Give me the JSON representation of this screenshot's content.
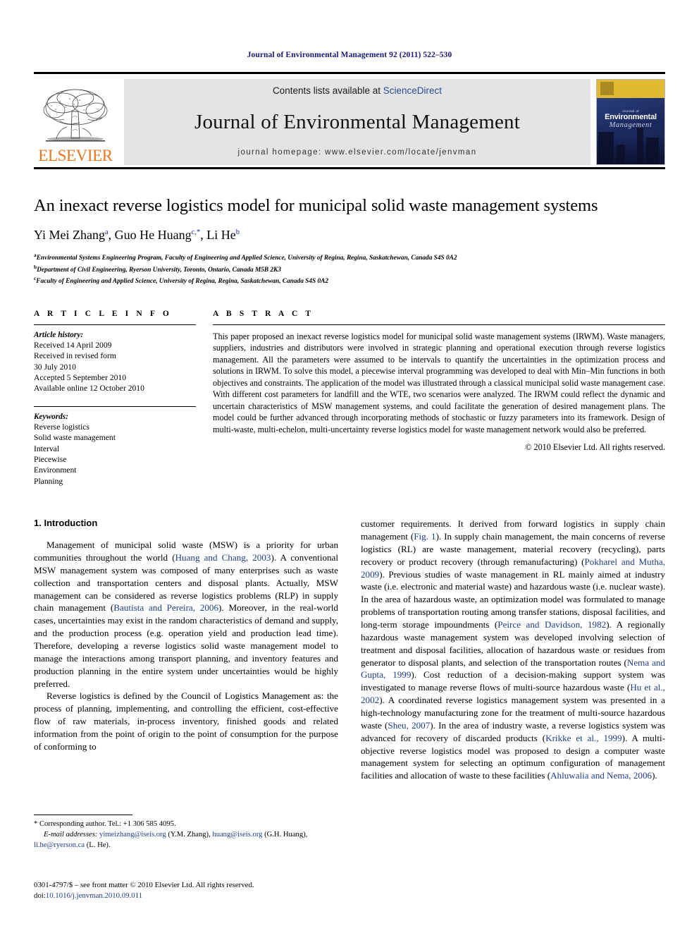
{
  "running_head": "Journal of Environmental Management 92 (2011) 522–530",
  "masthead": {
    "elsevier_wordmark": "ELSEVIER",
    "contents_prefix": "Contents lists available at ",
    "sciencedirect": "ScienceDirect",
    "journal_title": "Journal of Environmental Management",
    "homepage": "journal homepage: www.elsevier.com/locate/jenvman",
    "cover": {
      "sup": "Journal of",
      "line1": "Environmental",
      "line2": "Management"
    },
    "colors": {
      "link_blue": "#2a4b9b",
      "elsevier_orange": "#e87722",
      "banner_gray": "#e4e4e4",
      "cover_band": "#e0b832",
      "cover_blue": "#1d2f6b"
    }
  },
  "article": {
    "title": "An inexact reverse logistics model for municipal solid waste management systems",
    "authors_html": "Yi Mei Zhang <sup>a</sup>, Guo He Huang <sup>c,</sup>*, Li He <sup>b</sup>",
    "authors_plain": "Yi Mei Zhang a, Guo He Huang c,*, Li He b",
    "affiliations": [
      {
        "marker": "a",
        "text": "Environmental Systems Engineering Program, Faculty of Engineering and Applied Science, University of Regina, Regina, Saskatchewan, Canada S4S 0A2"
      },
      {
        "marker": "b",
        "text": "Department of Civil Engineering, Ryerson University, Toronto, Ontario, Canada M5B 2K3"
      },
      {
        "marker": "c",
        "text": "Faculty of Engineering and Applied Science, University of Regina, Regina, Saskatchewan, Canada S4S 0A2"
      }
    ]
  },
  "article_info": {
    "heading": "A R T I C L E   I N F O",
    "history_label": "Article history:",
    "history": [
      "Received 14 April 2009",
      "Received in revised form",
      "30 July 2010",
      "Accepted 5 September 2010",
      "Available online 12 October 2010"
    ],
    "keywords_label": "Keywords:",
    "keywords": [
      "Reverse logistics",
      "Solid waste management",
      "Interval",
      "Piecewise",
      "Environment",
      "Planning"
    ]
  },
  "abstract": {
    "heading": "A B S T R A C T",
    "text": "This paper proposed an inexact reverse logistics model for municipal solid waste management systems (IRWM). Waste managers, suppliers, industries and distributors were involved in strategic planning and operational execution through reverse logistics management. All the parameters were assumed to be intervals to quantify the uncertainties in the optimization process and solutions in IRWM. To solve this model, a piecewise interval programming was developed to deal with Min–Min functions in both objectives and constraints. The application of the model was illustrated through a classical municipal solid waste management case. With different cost parameters for landfill and the WTE, two scenarios were analyzed. The IRWM could reflect the dynamic and uncertain characteristics of MSW management systems, and could facilitate the generation of desired management plans. The model could be further advanced through incorporating methods of stochastic or fuzzy parameters into its framework. Design of multi-waste, multi-echelon, multi-uncertainty reverse logistics model for waste management network would also be preferred.",
    "copyright": "© 2010 Elsevier Ltd. All rights reserved."
  },
  "body": {
    "section_heading": "1. Introduction",
    "left_paragraphs": [
      "Management of municipal solid waste (MSW) is a priority for urban communities throughout the world (Huang and Chang, 2003). A conventional MSW management system was composed of many enterprises such as waste collection and transportation centers and disposal plants. Actually, MSW management can be considered as reverse logistics problems (RLP) in supply chain management (Bautista and Pereira, 2006). Moreover, in the real-world cases, uncertainties may exist in the random characteristics of demand and supply, and the production process (e.g. operation yield and production lead time). Therefore, developing a reverse logistics solid waste management model to manage the interactions among transport planning, and inventory features and production planning in the entire system under uncertainties would be highly preferred.",
      "Reverse logistics is defined by the Council of Logistics Management as: the process of planning, implementing, and controlling the efficient, cost-effective flow of raw materials, in-process inventory, finished goods and related information from the point of origin to the point of consumption for the purpose of conforming to"
    ],
    "right_paragraphs": [
      "customer requirements. It derived from forward logistics in supply chain management (Fig. 1). In supply chain management, the main concerns of reverse logistics (RL) are waste management, material recovery (recycling), parts recovery or product recovery (through remanufacturing) (Pokharel and Mutha, 2009). Previous studies of waste management in RL mainly aimed at industry waste (i.e. electronic and material waste) and hazardous waste (i.e. nuclear waste). In the area of hazardous waste, an optimization model was formulated to manage problems of transportation routing among transfer stations, disposal facilities, and long-term storage impoundments (Peirce and Davidson, 1982). A regionally hazardous waste management system was developed involving selection of treatment and disposal facilities, allocation of hazardous waste or residues from generator to disposal plants, and selection of the transportation routes (Nema and Gupta, 1999). Cost reduction of a decision-making support system was investigated to manage reverse flows of multi-source hazardous waste (Hu et al., 2002). A coordinated reverse logistics management system was presented in a high-technology manufacturing zone for the treatment of multi-source hazardous waste (Sheu, 2007). In the area of industry waste, a reverse logistics system was advanced for recovery of discarded products (Krikke et al., 1999). A multi-objective reverse logistics model was proposed to design a computer waste management system for selecting an optimum configuration of management facilities and allocation of waste to these facilities (Ahluwalia and Nema, 2006)."
    ],
    "citations": [
      "Huang and Chang, 2003",
      "Bautista and Pereira, 2006",
      "Fig. 1",
      "Pokharel and Mutha, 2009",
      "Peirce and Davidson, 1982",
      "Nema and Gupta, 1999",
      "Hu et al., 2002",
      "Sheu, 2007",
      "Krikke et al., 1999",
      "Ahluwalia and Nema, 2006"
    ]
  },
  "footnote": {
    "corresponding": "* Corresponding author. Tel.: +1 306 585 4095.",
    "email_label": "E-mail addresses:",
    "emails": [
      {
        "address": "yimeizhang@iseis.org",
        "owner": "(Y.M. Zhang)"
      },
      {
        "address": "huang@iseis.org",
        "owner": "(G.H. Huang)"
      },
      {
        "address": "li.he@ryerson.ca",
        "owner": "(L. He)"
      }
    ]
  },
  "issn": {
    "line1": "0301-4797/$ – see front matter © 2010 Elsevier Ltd. All rights reserved.",
    "doi_prefix": "doi:",
    "doi": "10.1016/j.jenvman.2010.09.011"
  }
}
